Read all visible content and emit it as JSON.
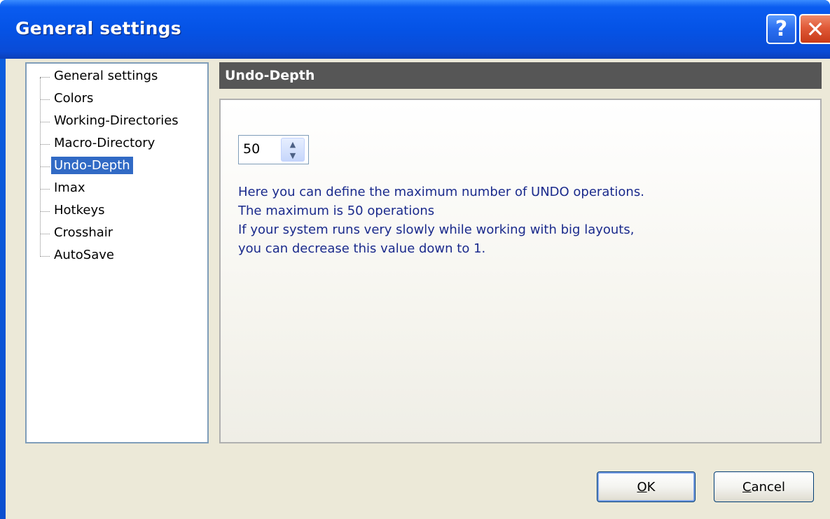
{
  "window": {
    "title": "General settings",
    "help_label": "?",
    "close_label": "✕"
  },
  "tree": {
    "items": [
      {
        "label": "General settings"
      },
      {
        "label": "Colors"
      },
      {
        "label": "Working-Directories"
      },
      {
        "label": "Macro-Directory"
      },
      {
        "label": "Undo-Depth",
        "selected": true
      },
      {
        "label": "Imax"
      },
      {
        "label": "Hotkeys"
      },
      {
        "label": "Crosshair"
      },
      {
        "label": "AutoSave"
      }
    ]
  },
  "panel": {
    "header": "Undo-Depth",
    "undo_depth": {
      "value": "50",
      "up_icon": "chevron-up-icon",
      "down_icon": "chevron-down-icon"
    },
    "description": [
      "Here you can define the maximum number of UNDO operations.",
      "The maximum is 50 operations",
      "If your system runs very slowly while working with big layouts,",
      "you can decrease this value down to 1."
    ]
  },
  "buttons": {
    "ok_first": "O",
    "ok_rest": "K",
    "cancel_first": "C",
    "cancel_rest": "ancel"
  },
  "colors": {
    "selection": "#316ac5",
    "header_bg": "#565656",
    "text_blue": "#1a2a8c"
  }
}
